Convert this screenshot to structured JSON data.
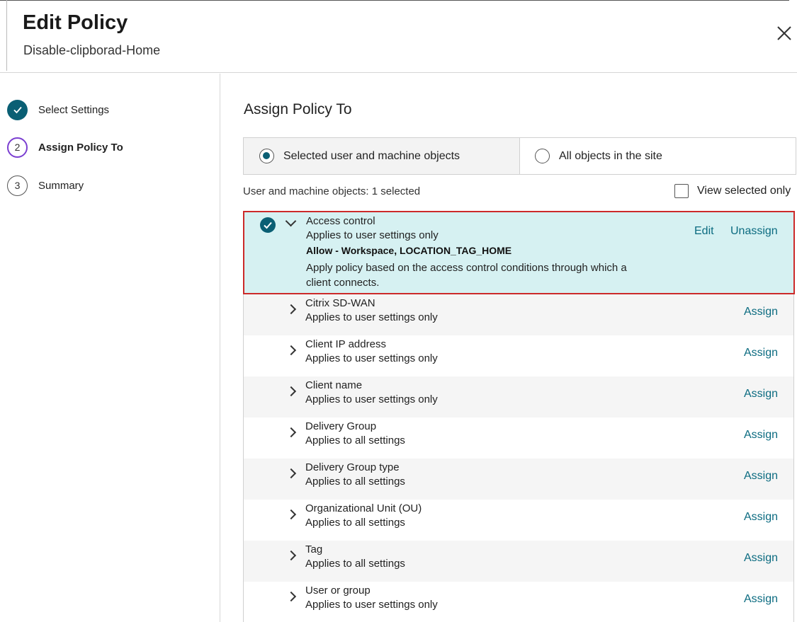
{
  "dialog": {
    "title": "Edit Policy",
    "subtitle": "Disable-clipborad-Home"
  },
  "colors": {
    "accent": "#0a5f74",
    "active_step": "#7b3fd1",
    "link": "#0b6b80",
    "selected_row_bg": "#d6f1f2",
    "highlight_border": "#cc2a2a"
  },
  "steps": [
    {
      "number": "",
      "label": "Select Settings",
      "state": "done"
    },
    {
      "number": "2",
      "label": "Assign Policy To",
      "state": "active"
    },
    {
      "number": "3",
      "label": "Summary",
      "state": "todo"
    }
  ],
  "main": {
    "section_title": "Assign Policy To",
    "radio_options": [
      {
        "label": "Selected user and machine objects",
        "selected": true
      },
      {
        "label": "All objects in the site",
        "selected": false
      }
    ],
    "count_label": "User and machine objects: 1 selected",
    "view_selected_label": "View selected only",
    "view_selected_checked": false
  },
  "objects": [
    {
      "name": "Access control",
      "description": "Applies to user settings only",
      "detail_bold": "Allow - Workspace, LOCATION_TAG_HOME",
      "detail_text": "Apply policy based on the access control conditions through which a client connects.",
      "edit_label": "Edit",
      "unassign_label": "Unassign",
      "assigned": true,
      "expanded": true
    },
    {
      "name": "Citrix SD-WAN",
      "description": "Applies to user settings only",
      "action": "Assign"
    },
    {
      "name": "Client IP address",
      "description": "Applies to user settings only",
      "action": "Assign"
    },
    {
      "name": "Client name",
      "description": "Applies to user settings only",
      "action": "Assign"
    },
    {
      "name": "Delivery Group",
      "description": "Applies to all settings",
      "action": "Assign"
    },
    {
      "name": "Delivery Group type",
      "description": "Applies to all settings",
      "action": "Assign"
    },
    {
      "name": "Organizational Unit (OU)",
      "description": "Applies to all settings",
      "action": "Assign"
    },
    {
      "name": "Tag",
      "description": "Applies to all settings",
      "action": "Assign"
    },
    {
      "name": "User or group",
      "description": "Applies to user settings only",
      "action": "Assign"
    }
  ]
}
